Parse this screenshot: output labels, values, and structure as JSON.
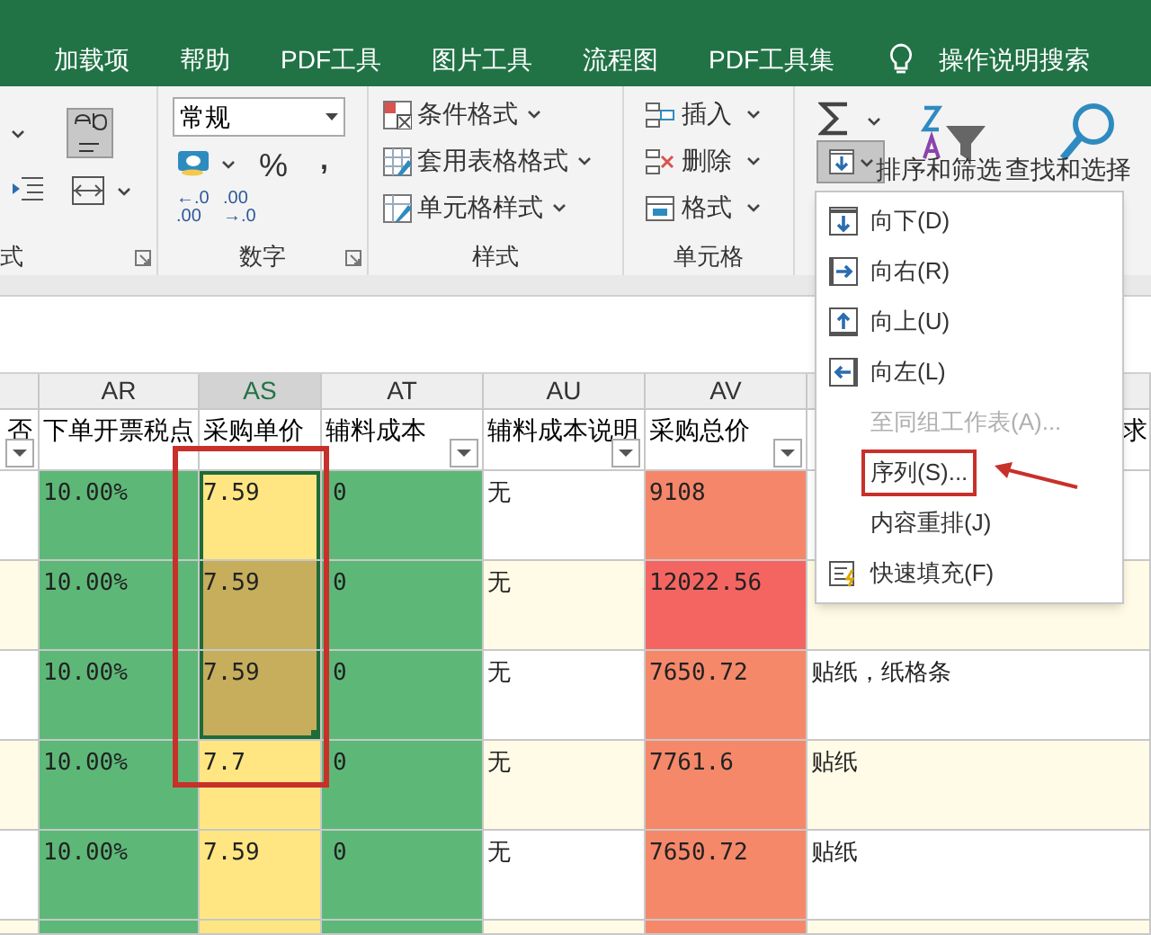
{
  "ribbon_tabs": [
    {
      "label": "加载项"
    },
    {
      "label": "帮助"
    },
    {
      "label": "PDF工具"
    },
    {
      "label": "图片工具"
    },
    {
      "label": "流程图"
    },
    {
      "label": "PDF工具集"
    }
  ],
  "tell_me": "操作说明搜索",
  "ribbon": {
    "alignment_group": {
      "label": "式"
    },
    "number_group": {
      "label": "数字",
      "format": "常规",
      "percent": "%",
      "comma": ",",
      "decimals": [
        {
          "top": "←.0",
          "bottom": ".00"
        },
        {
          "top": ".00",
          "bottom": "→.0"
        }
      ]
    },
    "styles_group": {
      "label": "样式",
      "buttons": [
        {
          "label": "条件格式",
          "kind": "conditional"
        },
        {
          "label": "套用表格格式",
          "kind": "table"
        },
        {
          "label": "单元格样式",
          "kind": "cellstyle"
        }
      ]
    },
    "cells_group": {
      "label": "单元格",
      "buttons": [
        {
          "label": "插入",
          "kind": "insert"
        },
        {
          "label": "删除",
          "kind": "delete"
        },
        {
          "label": "格式",
          "kind": "format"
        }
      ]
    },
    "editing_group": {
      "fill_button": {
        "selected": true
      },
      "sort_label": "排序和筛选",
      "find_label": "查找和选择"
    }
  },
  "columns": [
    {
      "header": "否",
      "filter": true,
      "selected": false
    },
    {
      "letter": "AR",
      "header": "下单开票税点",
      "filter": false,
      "selected": false
    },
    {
      "letter": "AS",
      "header": "采购单价",
      "filter": false,
      "selected": true
    },
    {
      "letter": "AT",
      "header": "辅料成本",
      "filter": true,
      "selected": false
    },
    {
      "letter": "AU",
      "header": "辅料成本说明",
      "filter": true,
      "selected": false
    },
    {
      "letter": "AV",
      "header": "采购总价",
      "filter": true,
      "selected": false
    },
    {
      "header": "求",
      "filter": false,
      "selected": false
    }
  ],
  "grid_annotation": {
    "kind": "box"
  },
  "rows": [
    {
      "cells": [
        {
          "color": "#ffffff",
          "selected": false
        },
        {
          "text": "10.00%",
          "color": "#5db878",
          "selected": false
        },
        {
          "text": "7.59",
          "color": "#ffe682",
          "selected": true
        },
        {
          "text": "0",
          "color": "#5db878",
          "selected": false
        },
        {
          "text": "无",
          "color": "#ffffff",
          "selected": false
        },
        {
          "text": "9108",
          "color": "#f6866a",
          "selected": false
        },
        {
          "color": "#ffffff",
          "selected": false
        }
      ]
    },
    {
      "cells": [
        {
          "color": "#fffbe6",
          "selected": false
        },
        {
          "text": "10.00%",
          "color": "#5db878",
          "selected": false
        },
        {
          "text": "7.59",
          "color": "#c6ae5c",
          "selected": true
        },
        {
          "text": "0",
          "color": "#5db878",
          "selected": false
        },
        {
          "text": "无",
          "color": "#fffbe6",
          "selected": false
        },
        {
          "text": "12022.56",
          "color": "#f46562",
          "selected": false
        },
        {
          "color": "#fffbe6",
          "selected": false
        }
      ]
    },
    {
      "cells": [
        {
          "color": "#ffffff",
          "selected": false
        },
        {
          "text": "10.00%",
          "color": "#5db878",
          "selected": false
        },
        {
          "text": "7.59",
          "color": "#c6ae5c",
          "selected": true
        },
        {
          "text": "0",
          "color": "#5db878",
          "selected": false
        },
        {
          "text": "无",
          "color": "#ffffff",
          "selected": false
        },
        {
          "text": "7650.72",
          "color": "#f6886a",
          "selected": false
        },
        {
          "text": "贴纸，纸格条",
          "color": "#ffffff",
          "selected": false
        }
      ]
    },
    {
      "cells": [
        {
          "color": "#fffbe6",
          "selected": false
        },
        {
          "text": "10.00%",
          "color": "#5db878",
          "selected": false
        },
        {
          "text": "7.7",
          "color": "#ffe682",
          "selected": false
        },
        {
          "text": "0",
          "color": "#5db878",
          "selected": false
        },
        {
          "text": "无",
          "color": "#fffbe6",
          "selected": false
        },
        {
          "text": "7761.6",
          "color": "#f6886a",
          "selected": false
        },
        {
          "text": "贴纸",
          "color": "#fffbe6",
          "selected": false
        }
      ]
    },
    {
      "cells": [
        {
          "color": "#ffffff",
          "selected": false
        },
        {
          "text": "10.00%",
          "color": "#5db878",
          "selected": false
        },
        {
          "text": "7.59",
          "color": "#ffe682",
          "selected": false
        },
        {
          "text": "0",
          "color": "#5db878",
          "selected": false
        },
        {
          "text": "无",
          "color": "#ffffff",
          "selected": false
        },
        {
          "text": "7650.72",
          "color": "#f6886a",
          "selected": false
        },
        {
          "text": "贴纸",
          "color": "#ffffff",
          "selected": false
        }
      ]
    },
    {
      "cells": [
        {
          "color": "#fffbe6",
          "selected": false
        },
        {
          "color": "#5db878",
          "selected": false
        },
        {
          "color": "#ffe682",
          "selected": false
        },
        {
          "color": "#5db878",
          "selected": false
        },
        {
          "color": "#fffbe6",
          "selected": false
        },
        {
          "color": "#f6886a",
          "selected": false
        },
        {
          "color": "#fffbe6",
          "selected": false
        }
      ]
    }
  ],
  "fill_menu": [
    {
      "label": "向下(D)",
      "kind": "down",
      "disabled": false,
      "annotated": false
    },
    {
      "label": "向右(R)",
      "kind": "right",
      "disabled": false,
      "annotated": false
    },
    {
      "label": "向上(U)",
      "kind": "up",
      "disabled": false,
      "annotated": false
    },
    {
      "label": "向左(L)",
      "kind": "left",
      "disabled": false,
      "annotated": false
    },
    {
      "label": "至同组工作表(A)...",
      "kind": "plain",
      "disabled": true,
      "annotated": false
    },
    {
      "label": "序列(S)...",
      "kind": "plain",
      "disabled": false,
      "annotated": true
    },
    {
      "label": "内容重排(J)",
      "kind": "plain",
      "disabled": false,
      "annotated": false
    },
    {
      "label": "快速填充(F)",
      "kind": "flash",
      "disabled": false,
      "annotated": false
    }
  ]
}
